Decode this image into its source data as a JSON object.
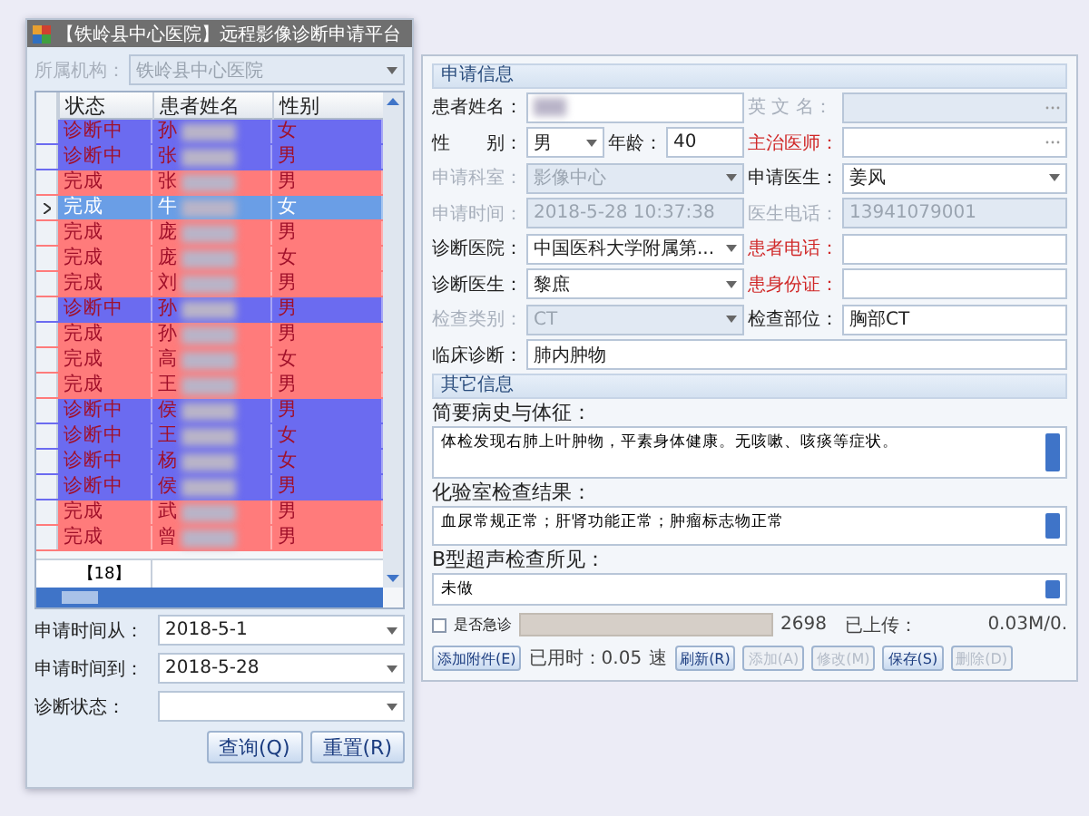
{
  "left_window": {
    "title": "【铁岭县中心医院】远程影像诊断申请平台",
    "org": {
      "label": "所属机构：",
      "value": "铁岭县中心医院",
      "disabled": true
    },
    "grid": {
      "columns": [
        "状态",
        "患者姓名",
        "性别"
      ],
      "rows": [
        {
          "status": "诊断中",
          "name": "孙",
          "sex": "女",
          "color": "#6b6bf0",
          "selected": false
        },
        {
          "status": "诊断中",
          "name": "张",
          "sex": "男",
          "color": "#6b6bf0",
          "selected": false
        },
        {
          "status": "完成",
          "name": "张",
          "sex": "男",
          "color": "#ff7b7b",
          "selected": false
        },
        {
          "status": "完成",
          "name": "牛",
          "sex": "女",
          "color": "#ff7b7b",
          "selected": true
        },
        {
          "status": "完成",
          "name": "庞",
          "sex": "男",
          "color": "#ff7b7b",
          "selected": false
        },
        {
          "status": "完成",
          "name": "庞",
          "sex": "女",
          "color": "#ff7b7b",
          "selected": false
        },
        {
          "status": "完成",
          "name": "刘",
          "sex": "男",
          "color": "#ff7b7b",
          "selected": false
        },
        {
          "status": "诊断中",
          "name": "孙",
          "sex": "男",
          "color": "#6b6bf0",
          "selected": false
        },
        {
          "status": "完成",
          "name": "孙",
          "sex": "男",
          "color": "#ff7b7b",
          "selected": false
        },
        {
          "status": "完成",
          "name": "高",
          "sex": "女",
          "color": "#ff7b7b",
          "selected": false
        },
        {
          "status": "完成",
          "name": "王",
          "sex": "男",
          "color": "#ff7b7b",
          "selected": false
        },
        {
          "status": "诊断中",
          "name": "侯",
          "sex": "男",
          "color": "#6b6bf0",
          "selected": false
        },
        {
          "status": "诊断中",
          "name": "王",
          "sex": "女",
          "color": "#6b6bf0",
          "selected": false
        },
        {
          "status": "诊断中",
          "name": "杨",
          "sex": "女",
          "color": "#6b6bf0",
          "selected": false
        },
        {
          "status": "诊断中",
          "name": "侯",
          "sex": "男",
          "color": "#6b6bf0",
          "selected": false
        },
        {
          "status": "完成",
          "name": "武",
          "sex": "男",
          "color": "#ff7b7b",
          "selected": false
        },
        {
          "status": "完成",
          "name": "曾",
          "sex": "男",
          "color": "#ff7b7b",
          "selected": false
        }
      ],
      "count": "【18】"
    },
    "filters": [
      {
        "label": "申请时间从：",
        "value": "2018-5-1"
      },
      {
        "label": "申请时间到：",
        "value": "2018-5-28"
      },
      {
        "label": "诊断状态："
      }
    ],
    "buttons": [
      "查询(Q)",
      "重置(R)"
    ]
  },
  "right_panel": {
    "sections": [
      {
        "title": "申请信息",
        "rows": [
          {
            "left": [
              {
                "label": "患者姓名：",
                "kind": "text",
                "blurred": true
              }
            ],
            "right": [
              {
                "label": "英 文 名：",
                "kind": "lookup",
                "disabled": true
              }
            ]
          },
          {
            "left": [
              {
                "label": "性　　别：",
                "kind": "dropdown",
                "value": "男"
              },
              {
                "label": "年龄：",
                "kind": "text",
                "value": "40"
              }
            ],
            "right": [
              {
                "label": "主治医师：",
                "kind": "lookup",
                "required": true
              }
            ]
          },
          {
            "left": [
              {
                "label": "申请科室：",
                "kind": "dropdown",
                "value": "影像中心",
                "disabled": true
              }
            ],
            "right": [
              {
                "label": "申请医生：",
                "kind": "dropdown",
                "value": "姜风"
              }
            ]
          },
          {
            "left": [
              {
                "label": "申请时间：",
                "kind": "text",
                "value": "2018-5-28 10:37:38",
                "disabled": true
              }
            ],
            "right": [
              {
                "label": "医生电话：",
                "kind": "text",
                "value": "13941079001",
                "disabled": true
              }
            ]
          },
          {
            "left": [
              {
                "label": "诊断医院：",
                "kind": "dropdown",
                "value": "中国医科大学附属第..."
              }
            ],
            "right": [
              {
                "label": "患者电话：",
                "kind": "text",
                "required": true
              }
            ]
          },
          {
            "left": [
              {
                "label": "诊断医生：",
                "kind": "dropdown",
                "value": "黎庶"
              }
            ],
            "right": [
              {
                "label": "患身份证：",
                "kind": "text",
                "required": true
              }
            ]
          },
          {
            "left": [
              {
                "label": "检查类别：",
                "kind": "dropdown",
                "value": "CT",
                "disabled": true
              }
            ],
            "right": [
              {
                "label": "检查部位：",
                "kind": "text",
                "value": "胸部CT"
              }
            ]
          },
          {
            "left": [
              {
                "label": "临床诊断：",
                "kind": "text",
                "value": "肺内肿物"
              }
            ]
          }
        ]
      },
      {
        "title": "其它信息",
        "notes": [
          {
            "label": "简要病史与体征：",
            "value": "体检发现右肺上叶肿物，平素身体健康。无咳嗽、咳痰等症状。"
          },
          {
            "label": "化验室检查结果：",
            "value": "血尿常规正常；肝肾功能正常；肿瘤标志物正常"
          },
          {
            "label": "B型超声检查所见：",
            "value": "未做"
          }
        ]
      }
    ],
    "urgent": {
      "label": "是否急诊",
      "checked": false
    },
    "upload": {
      "level": 0,
      "size": "2698",
      "uploaded_label": "已上传：",
      "speed": "0.03M/0."
    },
    "attach_button": "添加附件(E)",
    "elapsed": "已用时：0.05",
    "speed_label": "速",
    "buttons": [
      {
        "label": "刷新(R)",
        "disabled": false
      },
      {
        "label": "添加(A)",
        "disabled": true
      },
      {
        "label": "修改(M)",
        "disabled": true
      },
      {
        "label": "保存(S)",
        "disabled": false
      },
      {
        "label": "删除(D)",
        "disabled": true
      }
    ]
  }
}
